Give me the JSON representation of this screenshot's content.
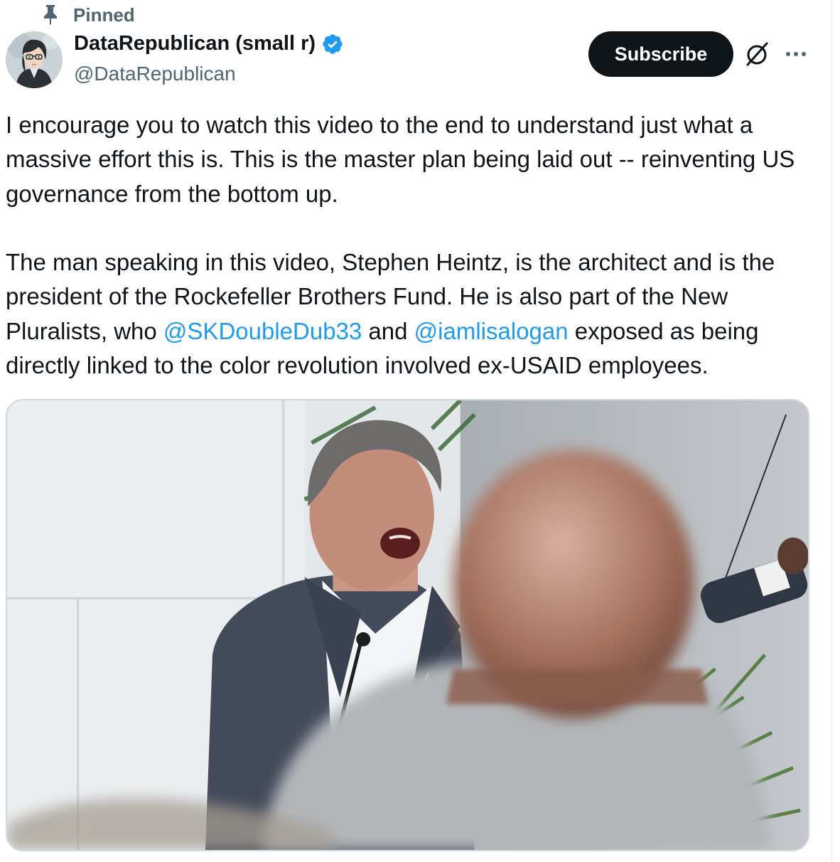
{
  "pinned": {
    "label": "Pinned",
    "icon": "pin-icon"
  },
  "author": {
    "display_name": "DataRepublican (small r)",
    "handle": "@DataRepublican",
    "verified": true,
    "verified_color": "#1d9bf0",
    "avatar_icon": "avatar"
  },
  "actions": {
    "subscribe_label": "Subscribe",
    "grok_icon": "grok-icon",
    "more_icon": "more-icon"
  },
  "tweet": {
    "p1": "I encourage you to watch this video to the end to understand just what a massive effort this is. This is the master plan being laid out -- reinventing US governance from the bottom up.",
    "p2_a": "The man speaking in this video, Stephen Heintz, is the architect and is the president of the Rockefeller Brothers Fund. He is also part of the New Pluralists, who ",
    "mention_1": "@SKDoubleDub33",
    "p2_b": " and ",
    "mention_2": "@iamlisalogan",
    "p2_c": " exposed as being directly linked to the color revolution involved ex-USAID employees."
  },
  "media": {
    "type": "video-thumbnail"
  },
  "colors": {
    "text": "#0f1419",
    "secondary": "#536471",
    "link": "#1d9bf0",
    "button_bg": "#0f1419",
    "button_text": "#ffffff"
  }
}
